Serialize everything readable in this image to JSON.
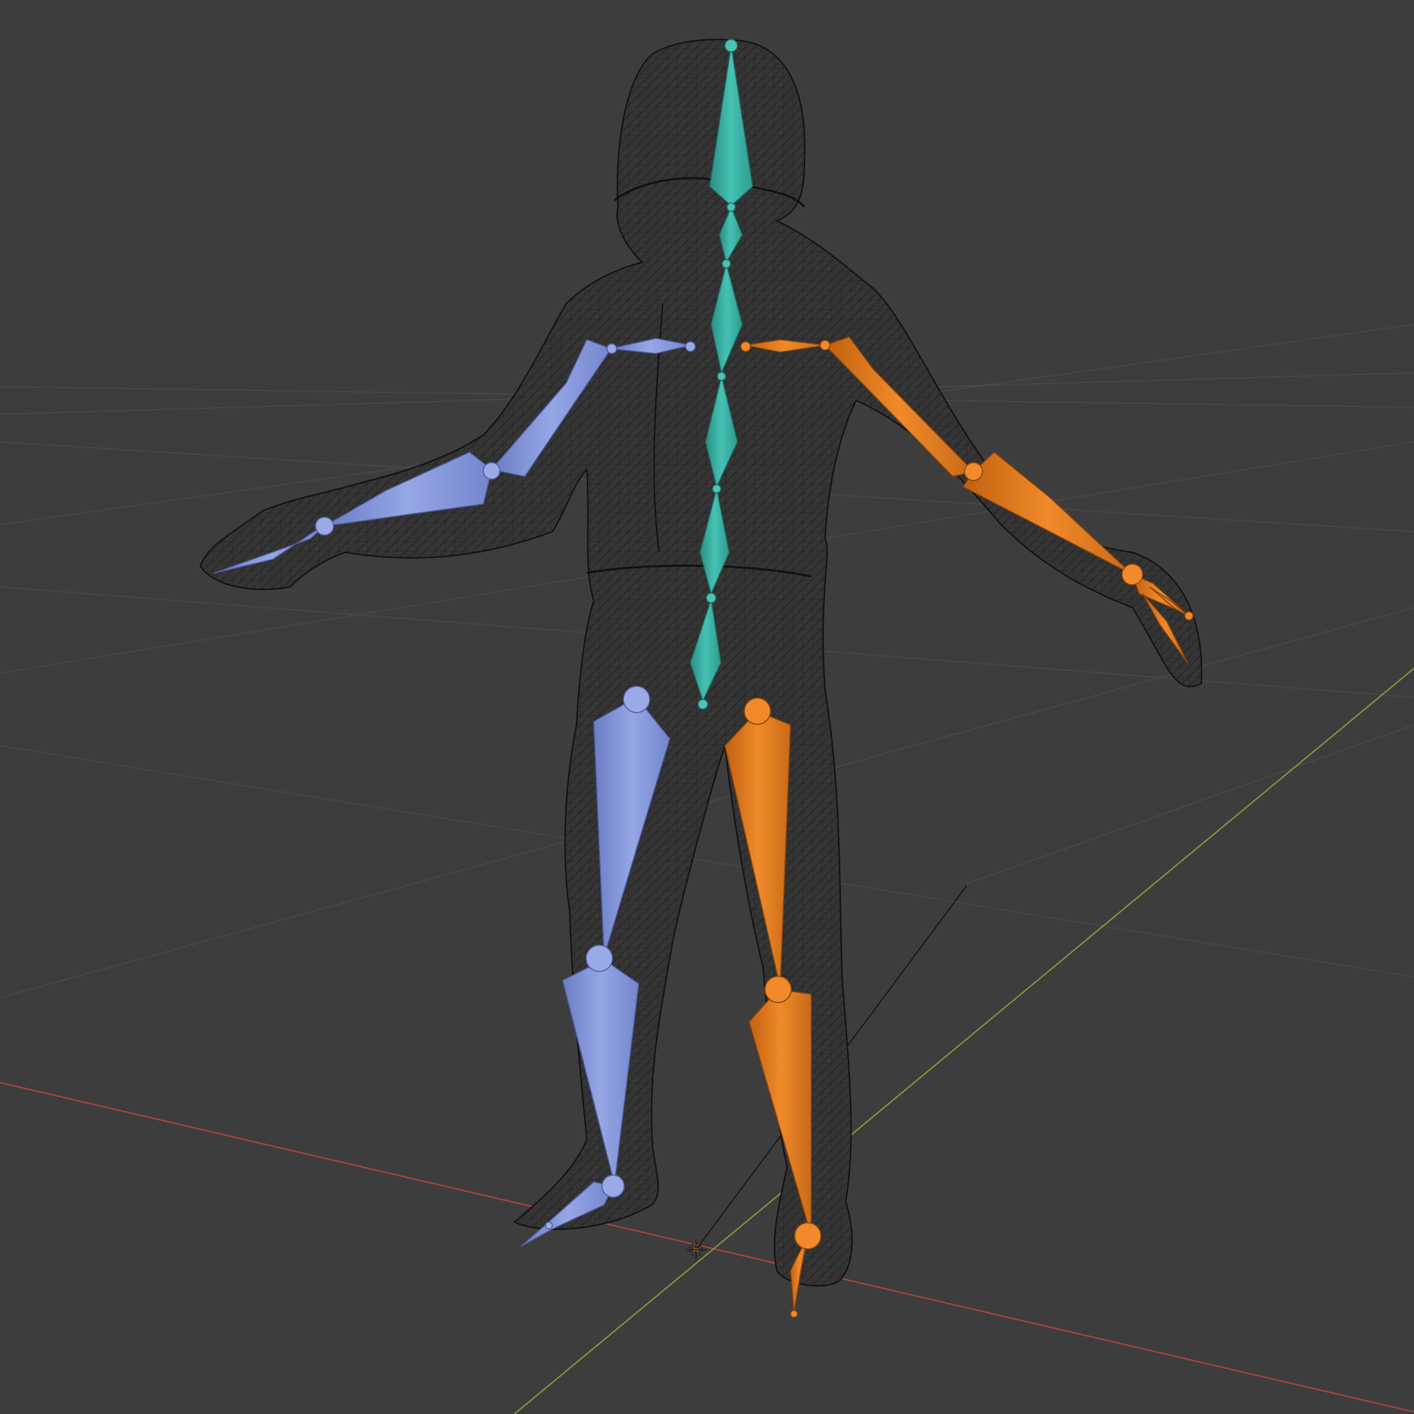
{
  "viewport": {
    "background_color": "#3d3d3d",
    "grid_color": "#4a4a4a",
    "x_axis_color": "#b0413e",
    "y_axis_color": "#7a9b3a"
  },
  "mesh": {
    "wire_color": "#111111",
    "fill_color": "#363636"
  },
  "armature": {
    "center_color": "#3fb5a8",
    "left_side_color": "#7c8fd6",
    "right_side_color": "#e07820"
  },
  "icons": {
    "origin": "3d-cursor-icon"
  }
}
